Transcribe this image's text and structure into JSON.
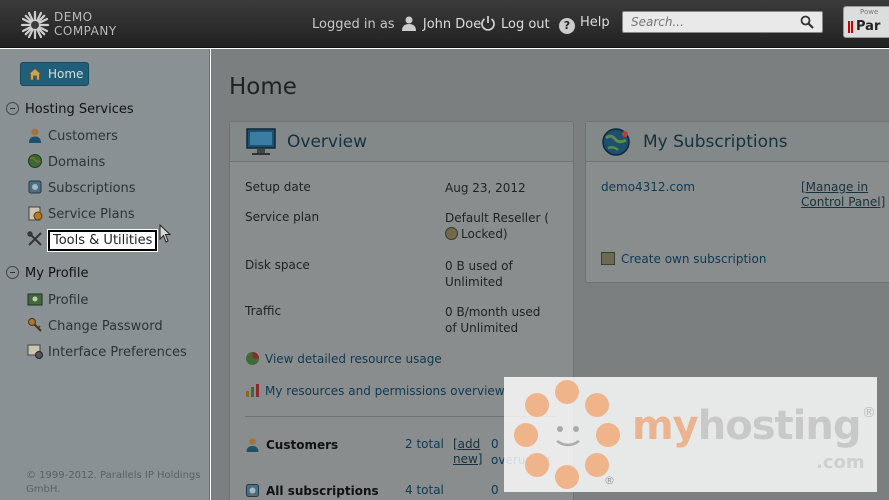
{
  "header": {
    "logo_line1": "DEMO",
    "logo_line2": "COMPANY",
    "logged_in_prefix": "Logged in as",
    "username": "John Doe",
    "logout_label": "Log out",
    "help_label": "Help",
    "search_placeholder": "Search...",
    "vendor_small": "Powe",
    "vendor_label": "Par"
  },
  "sidebar": {
    "home_label": "Home",
    "sections": [
      {
        "title": "Hosting Services",
        "items": [
          {
            "label": "Customers",
            "icon": "user-icon"
          },
          {
            "label": "Domains",
            "icon": "globe-icon"
          },
          {
            "label": "Subscriptions",
            "icon": "subscription-icon"
          },
          {
            "label": "Service Plans",
            "icon": "service-plan-icon"
          },
          {
            "label": "Tools & Utilities",
            "icon": "tools-icon",
            "active": true
          }
        ]
      },
      {
        "title": "My Profile",
        "items": [
          {
            "label": "Profile",
            "icon": "profile-card-icon"
          },
          {
            "label": "Change Password",
            "icon": "key-icon"
          },
          {
            "label": "Interface Preferences",
            "icon": "preferences-icon"
          }
        ]
      }
    ],
    "copyright": "© 1999-2012. Parallels IP Holdings GmbH."
  },
  "main": {
    "title": "Home",
    "overview": {
      "title": "Overview",
      "rows": [
        {
          "label": "Setup date",
          "value": "Aug 23, 2012"
        },
        {
          "label": "Service plan",
          "value_line1": "Default Reseller (",
          "value_line2": "Locked)"
        },
        {
          "label": "Disk space",
          "value": "0 B used of Unlimited"
        },
        {
          "label": "Traffic",
          "value": "0 B/month used of Unlimited"
        }
      ],
      "links": [
        {
          "label": "View detailed resource usage"
        },
        {
          "label": "My resources and permissions overview"
        }
      ],
      "stats": [
        {
          "label": "Customers",
          "total": "2 total",
          "add": "[add new]",
          "count": "0",
          "note": "overusing"
        },
        {
          "label": "All subscriptions",
          "total": "4 total",
          "count": "0"
        }
      ]
    },
    "subscriptions": {
      "title": "My Subscriptions",
      "domain": "demo4312.com",
      "manage_label": "[Manage in Control Panel]",
      "create_label": "Create own subscription"
    }
  },
  "watermark": {
    "text_my": "my",
    "text_hosting": "hosting",
    "text_com": ".com",
    "registered": "®"
  },
  "colors": {
    "sidebar_bg": "#8a9194",
    "main_bg": "#7c7f80",
    "link": "#0e3a52",
    "home_button": "#1f5f7a",
    "watermark_orange": "#e9b48f"
  }
}
